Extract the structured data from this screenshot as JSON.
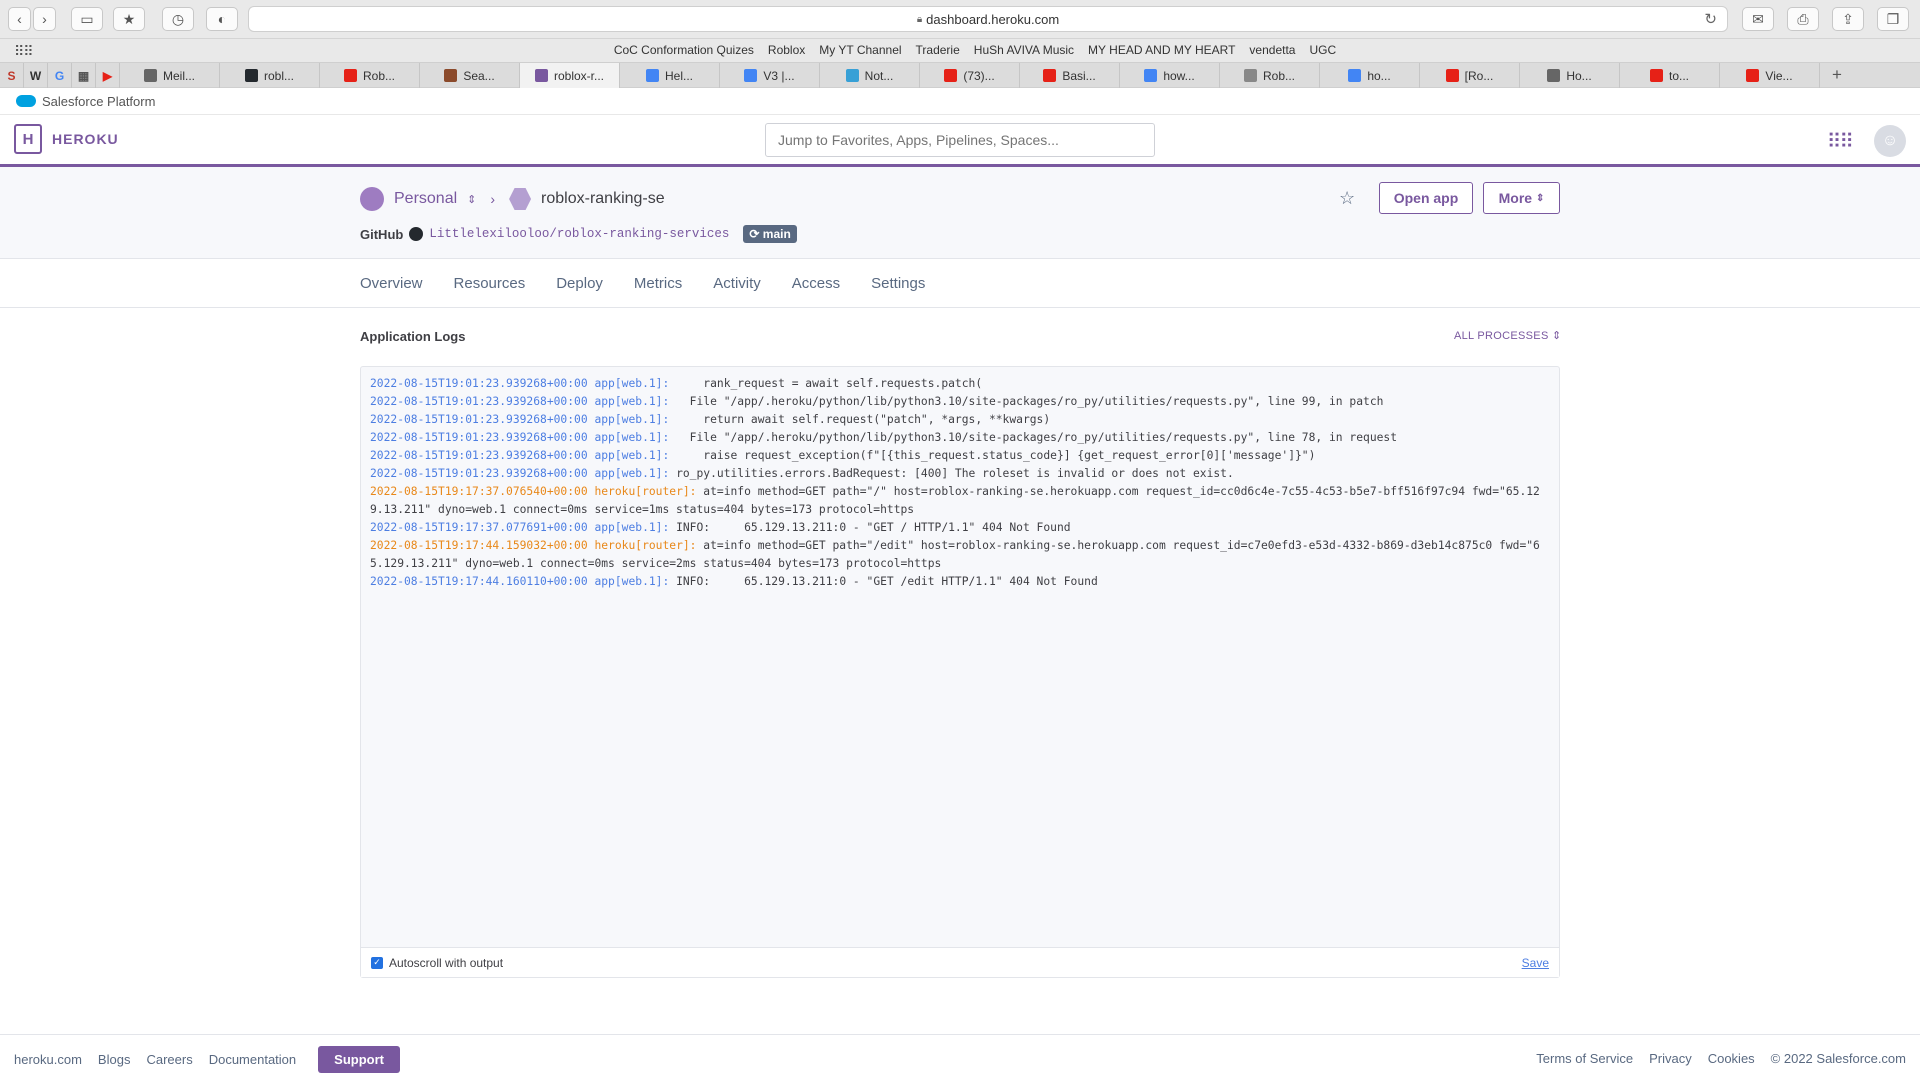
{
  "browser": {
    "url": "dashboard.heroku.com",
    "favorites": [
      "CoC Conformation Quizes",
      "Roblox",
      "My YT Channel",
      "Traderie",
      "HuSh AVIVA Music",
      "MY HEAD AND MY HEART",
      "vendetta",
      "UGC"
    ],
    "pinned_tabs": [
      "S",
      "W",
      "G",
      "▦",
      "▶"
    ],
    "tabs": [
      "Meil...",
      "robl...",
      "Rob...",
      "Sea...",
      "roblox-r...",
      "Hel...",
      "V3 |...",
      "Not...",
      "(73)...",
      "Basi...",
      "how...",
      "Rob...",
      "ho...",
      "[Ro...",
      "Ho...",
      "to...",
      "Vie..."
    ],
    "active_tab_index": 4
  },
  "salesforce": {
    "label": "Salesforce Platform"
  },
  "heroku": {
    "logo_mark": "H",
    "logo_text": "HEROKU",
    "search_placeholder": "Jump to Favorites, Apps, Pipelines, Spaces..."
  },
  "app": {
    "owner": "Personal",
    "name": "roblox-ranking-se",
    "github_label": "GitHub",
    "repo": "Littlelexilooloo/roblox-ranking-services",
    "branch": "main",
    "open_app": "Open app",
    "more": "More"
  },
  "nav": [
    "Overview",
    "Resources",
    "Deploy",
    "Metrics",
    "Activity",
    "Access",
    "Settings"
  ],
  "logs": {
    "title": "Application Logs",
    "all_processes": "ALL PROCESSES",
    "autoscroll_label": "Autoscroll with output",
    "save": "Save",
    "lines": [
      {
        "ts": "2022-08-15T19:01:23.939268+00:00",
        "src": "app[web.1]:",
        "kind": "app",
        "msg": "     rank_request = await self.requests.patch("
      },
      {
        "ts": "2022-08-15T19:01:23.939268+00:00",
        "src": "app[web.1]:",
        "kind": "app",
        "msg": "   File \"/app/.heroku/python/lib/python3.10/site-packages/ro_py/utilities/requests.py\", line 99, in patch"
      },
      {
        "ts": "2022-08-15T19:01:23.939268+00:00",
        "src": "app[web.1]:",
        "kind": "app",
        "msg": "     return await self.request(\"patch\", *args, **kwargs)"
      },
      {
        "ts": "2022-08-15T19:01:23.939268+00:00",
        "src": "app[web.1]:",
        "kind": "app",
        "msg": "   File \"/app/.heroku/python/lib/python3.10/site-packages/ro_py/utilities/requests.py\", line 78, in request"
      },
      {
        "ts": "2022-08-15T19:01:23.939268+00:00",
        "src": "app[web.1]:",
        "kind": "app",
        "msg": "     raise request_exception(f\"[{this_request.status_code}] {get_request_error[0]['message']}\")"
      },
      {
        "ts": "2022-08-15T19:01:23.939268+00:00",
        "src": "app[web.1]:",
        "kind": "app",
        "msg": " ro_py.utilities.errors.BadRequest: [400] The roleset is invalid or does not exist."
      },
      {
        "ts": "2022-08-15T19:17:37.076540+00:00",
        "src": "heroku[router]:",
        "kind": "heroku",
        "msg": " at=info method=GET path=\"/\" host=roblox-ranking-se.herokuapp.com request_id=cc0d6c4e-7c55-4c53-b5e7-bff516f97c94 fwd=\"65.129.13.211\" dyno=web.1 connect=0ms service=1ms status=404 bytes=173 protocol=https"
      },
      {
        "ts": "2022-08-15T19:17:37.077691+00:00",
        "src": "app[web.1]:",
        "kind": "app",
        "msg": " INFO:     65.129.13.211:0 - \"GET / HTTP/1.1\" 404 Not Found"
      },
      {
        "ts": "2022-08-15T19:17:44.159032+00:00",
        "src": "heroku[router]:",
        "kind": "heroku",
        "msg": " at=info method=GET path=\"/edit\" host=roblox-ranking-se.herokuapp.com request_id=c7e0efd3-e53d-4332-b869-d3eb14c875c0 fwd=\"65.129.13.211\" dyno=web.1 connect=0ms service=2ms status=404 bytes=173 protocol=https"
      },
      {
        "ts": "2022-08-15T19:17:44.160110+00:00",
        "src": "app[web.1]:",
        "kind": "app",
        "msg": " INFO:     65.129.13.211:0 - \"GET /edit HTTP/1.1\" 404 Not Found"
      }
    ]
  },
  "footer": {
    "left": [
      "heroku.com",
      "Blogs",
      "Careers",
      "Documentation"
    ],
    "support": "Support",
    "right": [
      "Terms of Service",
      "Privacy",
      "Cookies",
      "© 2022 Salesforce.com"
    ]
  },
  "colors": {
    "accent": "#79589f",
    "log_app": "#4d7ee2",
    "log_heroku": "#e8881a"
  }
}
